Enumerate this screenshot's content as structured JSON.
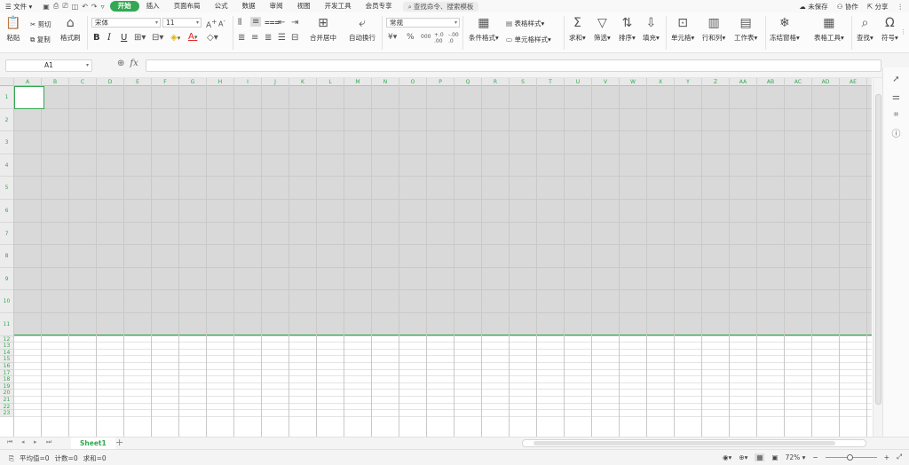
{
  "menubar": {
    "file_label": "文件",
    "tabs": [
      {
        "label": "开始",
        "active": true
      },
      {
        "label": "插入"
      },
      {
        "label": "页面布局"
      },
      {
        "label": "公式"
      },
      {
        "label": "数据"
      },
      {
        "label": "审阅"
      },
      {
        "label": "视图"
      },
      {
        "label": "开发工具"
      },
      {
        "label": "会员专享"
      }
    ],
    "search_placeholder": "查找命令、搜索模板",
    "unsaved": "未保存",
    "collab": "协作",
    "share": "分享"
  },
  "ribbon": {
    "paste": "粘贴",
    "cut": "剪切",
    "copy": "复制",
    "format_painter": "格式刷",
    "font_name": "宋体",
    "font_size": "11",
    "number_format": "常规",
    "merge_center": "合并居中",
    "wrap_text": "自动换行",
    "conditional_format": "条件格式",
    "table_style": "表格样式",
    "cell_style": "单元格样式",
    "sum": "求和",
    "filter": "筛选",
    "sort": "排序",
    "fill": "填充",
    "cells": "单元格",
    "rows_cols": "行和列",
    "worksheet": "工作表",
    "freeze": "冻结窗格",
    "table_tools": "表格工具",
    "find": "查找",
    "symbol": "符号",
    "bold": "B",
    "italic": "I",
    "underline": "U",
    "currency": "¥",
    "percent": "%",
    "thousands": "000",
    "font_color_letter": "A"
  },
  "formula": {
    "cell_ref": "A1",
    "fx": "fx",
    "value": ""
  },
  "sheet": {
    "columns": [
      "A",
      "B",
      "C",
      "D",
      "E",
      "F",
      "G",
      "H",
      "I",
      "J",
      "K",
      "L",
      "M",
      "N",
      "O",
      "P",
      "Q",
      "R",
      "S",
      "T",
      "U",
      "V",
      "W",
      "X",
      "Y",
      "Z",
      "AA",
      "AB",
      "AC",
      "AD",
      "AE"
    ],
    "rows": [
      "1",
      "2",
      "3",
      "4",
      "5",
      "6",
      "7",
      "8",
      "9",
      "10",
      "11",
      "12",
      "13",
      "14",
      "15",
      "16",
      "17",
      "18",
      "19",
      "20",
      "21",
      "22",
      "23"
    ],
    "tab_name": "Sheet1",
    "add_tab": "+"
  },
  "status": {
    "average": "平均值=0",
    "count": "计数=0",
    "sum": "求和=0",
    "zoom": "72%"
  },
  "colors": {
    "accent": "#33a853",
    "selection_fill": "#d9d9d9"
  }
}
